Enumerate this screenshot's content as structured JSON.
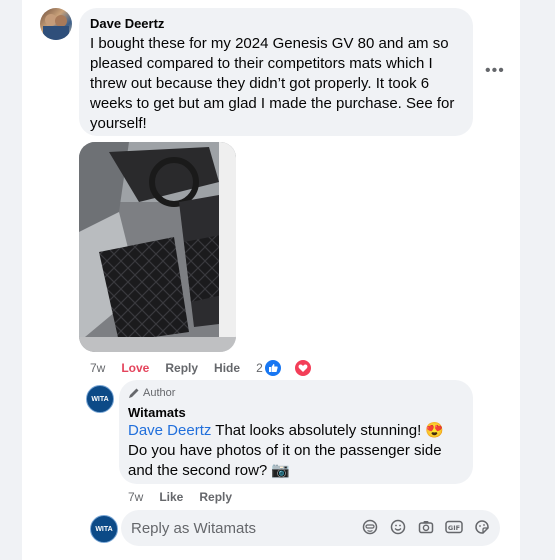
{
  "comment": {
    "author": "Dave Deertz",
    "text": "I bought these for my 2024 Genesis GV 80 and am so pleased compared to their competitors mats which I threw out because they didn’t got properly. It took 6 weeks to get but am glad I made the purchase. See for yourself!",
    "more_label": "•••",
    "time": "7w",
    "love_label": "Love",
    "reply_label": "Reply",
    "hide_label": "Hide",
    "reaction_count": "2",
    "reaction_icons": [
      "like-icon",
      "love-icon"
    ]
  },
  "reply": {
    "badge": "Author",
    "author": "Witamats",
    "avatar_text": "WITA",
    "mention": "Dave Deertz",
    "text": "That looks absolutely stunning! 😍 Do you have photos of it on the passenger side and the second row? 📷",
    "time": "7w",
    "like_label": "Like",
    "reply_label": "Reply"
  },
  "composer": {
    "placeholder": "Reply as Witamats",
    "avatar_text": "WITA",
    "icons": [
      "avatar-sticker-icon",
      "emoji-icon",
      "camera-icon",
      "gif-icon",
      "sticker-icon"
    ]
  },
  "colors": {
    "love": "#e4445c",
    "mention": "#216fdb",
    "like_blue": "#1877f2",
    "bubble": "#f0f2f5"
  }
}
